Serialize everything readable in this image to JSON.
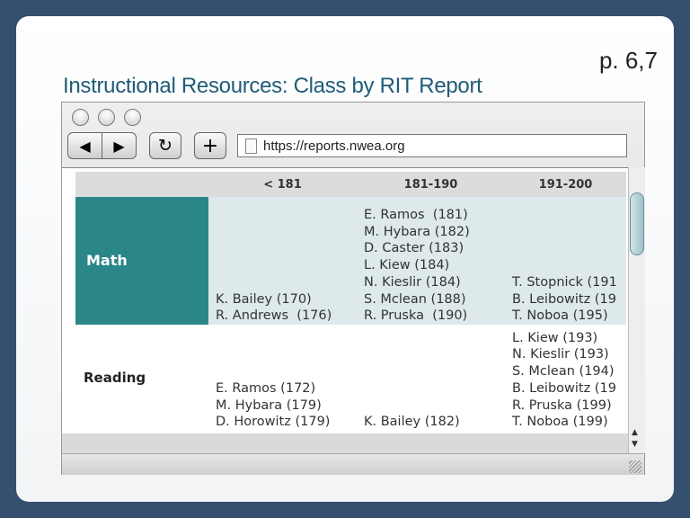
{
  "slide": {
    "title": "Instructional Resources: Class by RIT Report",
    "page_ref": "p. 6,7"
  },
  "browser": {
    "url": "https://reports.nwea.org",
    "back_icon": "back-arrow-icon",
    "forward_icon": "forward-arrow-icon",
    "reload_icon": "reload-icon",
    "add_icon": "plus-icon"
  },
  "table": {
    "columns": [
      "",
      "< 181",
      "181-190",
      "191-200"
    ],
    "rows": [
      {
        "label": "Math",
        "cells": [
          [
            "K. Bailey (170)",
            "R. Andrews  (176)"
          ],
          [
            "E. Ramos  (181)",
            "M. Hybara (182)",
            "D. Caster (183)",
            "L. Kiew (184)",
            "N. Kieslir (184)",
            "S. Mclean (188)",
            "R. Pruska  (190)"
          ],
          [
            "T. Stopnick (191",
            "B. Leibowitz (19",
            "T. Noboa (195)"
          ]
        ]
      },
      {
        "label": "Reading",
        "cells": [
          [
            "E. Ramos (172)",
            "M. Hybara (179)",
            "D. Horowitz (179)"
          ],
          [
            "K. Bailey (182)"
          ],
          [
            "L. Kiew (193)",
            "N. Kieslir (193)",
            "S. Mclean (194)",
            "B. Leibowitz (19",
            "R. Pruska (199)",
            "T. Noboa (199)"
          ]
        ]
      }
    ]
  },
  "colors": {
    "math_label_bg": "#2b8688",
    "math_row_bg": "#dde9ea",
    "background": "#34506e"
  }
}
